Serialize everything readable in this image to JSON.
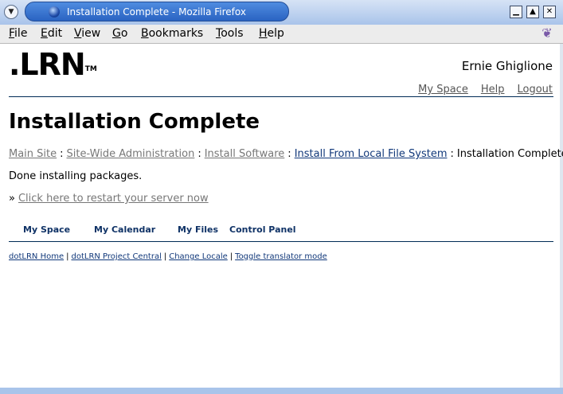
{
  "window": {
    "title": "Installation Complete - Mozilla Firefox",
    "menu_button_icon": "window-menu-icon",
    "controls": {
      "minimize": "▁",
      "maximize": "▲",
      "close": "✕"
    }
  },
  "menubar": {
    "items": [
      {
        "key": "F",
        "rest": "ile"
      },
      {
        "key": "E",
        "rest": "dit"
      },
      {
        "key": "V",
        "rest": "iew"
      },
      {
        "key": "G",
        "rest": "o"
      },
      {
        "key": "B",
        "rest": "ookmarks"
      },
      {
        "key": "T",
        "rest": "ools"
      },
      {
        "key": "H",
        "rest": "elp"
      }
    ],
    "throbber_glyph": "❦"
  },
  "header": {
    "logo_text": ".LRN",
    "logo_tm": "TM",
    "user_name": "Ernie Ghiglione",
    "links": [
      "My Space",
      "Help",
      "Logout"
    ]
  },
  "main": {
    "title": "Installation Complete",
    "breadcrumb": [
      {
        "label": "Main Site",
        "style": "gray"
      },
      {
        "label": "Site-Wide Administration",
        "style": "gray"
      },
      {
        "label": "Install Software",
        "style": "gray"
      },
      {
        "label": "Install From Local File System",
        "style": "blue"
      }
    ],
    "breadcrumb_current": "Installation Complete",
    "breadcrumb_separator": ":",
    "status": "Done installing packages.",
    "restart_prefix": "»",
    "restart_link": "Click here to restart your server now"
  },
  "nav_tabs": [
    "My Space",
    "My Calendar",
    "My Files",
    "Control Panel"
  ],
  "footer": {
    "links": [
      "dotLRN Home",
      "dotLRN Project Central",
      "Change Locale",
      "Toggle translator mode"
    ],
    "separator": "|"
  },
  "colors": {
    "title_bar": "#2a63c2",
    "link_blue": "#11387a",
    "link_gray": "#777777",
    "rule": "#002b55"
  }
}
